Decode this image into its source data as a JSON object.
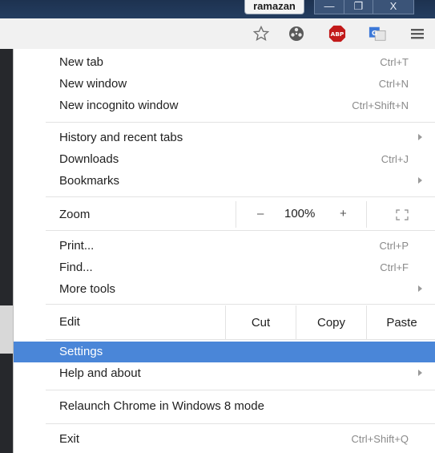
{
  "window": {
    "user": "ramazan",
    "minimize_glyph": "—",
    "restore_glyph": "❐",
    "close_glyph": "X"
  },
  "toolbar": {
    "icons": [
      "star-icon",
      "film-reel-icon",
      "adblock-icon",
      "translate-icon",
      "menu-icon"
    ],
    "abp_text": "ABP"
  },
  "menu": {
    "new_tab": {
      "label": "New tab",
      "shortcut": "Ctrl+T"
    },
    "new_window": {
      "label": "New window",
      "shortcut": "Ctrl+N"
    },
    "new_incognito": {
      "label": "New incognito window",
      "shortcut": "Ctrl+Shift+N"
    },
    "history": {
      "label": "History and recent tabs"
    },
    "downloads": {
      "label": "Downloads",
      "shortcut": "Ctrl+J"
    },
    "bookmarks": {
      "label": "Bookmarks"
    },
    "zoom": {
      "label": "Zoom",
      "minus": "–",
      "value": "100%",
      "plus": "+"
    },
    "print": {
      "label": "Print...",
      "shortcut": "Ctrl+P"
    },
    "find": {
      "label": "Find...",
      "shortcut": "Ctrl+F"
    },
    "more_tools": {
      "label": "More tools"
    },
    "edit": {
      "label": "Edit",
      "cut": "Cut",
      "copy": "Copy",
      "paste": "Paste"
    },
    "settings": {
      "label": "Settings",
      "highlight_color": "#4a86d8"
    },
    "help": {
      "label": "Help and about"
    },
    "relaunch": {
      "label": "Relaunch Chrome in Windows 8 mode"
    },
    "exit": {
      "label": "Exit",
      "shortcut": "Ctrl+Shift+Q"
    }
  }
}
